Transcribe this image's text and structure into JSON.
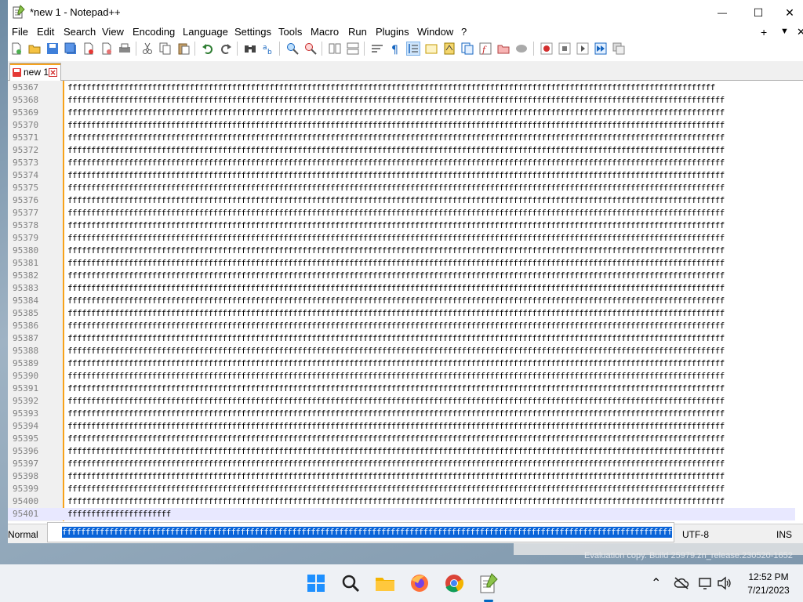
{
  "window": {
    "title": "*new 1 - Notepad++",
    "minimize_glyph": "—",
    "maximize_glyph": "☐",
    "close_glyph": "✕"
  },
  "menu": {
    "items": [
      "File",
      "Edit",
      "Search",
      "View",
      "Encoding",
      "Language",
      "Settings",
      "Tools",
      "Macro",
      "Run",
      "Plugins",
      "Window",
      "?"
    ],
    "right_plus": "+",
    "right_down": "▼",
    "right_close": "✕"
  },
  "tab": {
    "label": "new 1"
  },
  "editor": {
    "lines": [
      {
        "num": "95367",
        "text": "ffffffffffffffffffffffffffffffffffffffffffffffffffffffffffffffffffffffffffffffffffffffffffffffffffffffffffffffffffffffffffffffffffffffffff"
      },
      {
        "num": "95368",
        "text": "ffffffffffffffffffffffffffffffffffffffffffffffffffffffffffffffffffffffffffffffffffffffffffffffffffffffffffffffffffffffffffffffffffffffffffff"
      },
      {
        "num": "95369",
        "text": "ffffffffffffffffffffffffffffffffffffffffffffffffffffffffffffffffffffffffffffffffffffffffffffffffffffffffffffffffffffffffffffffffffffffffffff"
      },
      {
        "num": "95370",
        "text": "ffffffffffffffffffffffffffffffffffffffffffffffffffffffffffffffffffffffffffffffffffffffffffffffffffffffffffffffffffffffffffffffffffffffffffff"
      },
      {
        "num": "95371",
        "text": "ffffffffffffffffffffffffffffffffffffffffffffffffffffffffffffffffffffffffffffffffffffffffffffffffffffffffffffffffffffffffffffffffffffffffffff"
      },
      {
        "num": "95372",
        "text": "ffffffffffffffffffffffffffffffffffffffffffffffffffffffffffffffffffffffffffffffffffffffffffffffffffffffffffffffffffffffffffffffffffffffffffff"
      },
      {
        "num": "95373",
        "text": "ffffffffffffffffffffffffffffffffffffffffffffffffffffffffffffffffffffffffffffffffffffffffffffffffffffffffffffffffffffffffffffffffffffffffffff"
      },
      {
        "num": "95374",
        "text": "ffffffffffffffffffffffffffffffffffffffffffffffffffffffffffffffffffffffffffffffffffffffffffffffffffffffffffffffffffffffffffffffffffffffffffff"
      },
      {
        "num": "95375",
        "text": "ffffffffffffffffffffffffffffffffffffffffffffffffffffffffffffffffffffffffffffffffffffffffffffffffffffffffffffffffffffffffffffffffffffffffffff"
      },
      {
        "num": "95376",
        "text": "ffffffffffffffffffffffffffffffffffffffffffffffffffffffffffffffffffffffffffffffffffffffffffffffffffffffffffffffffffffffffffffffffffffffffffff"
      },
      {
        "num": "95377",
        "text": "ffffffffffffffffffffffffffffffffffffffffffffffffffffffffffffffffffffffffffffffffffffffffffffffffffffffffffffffffffffffffffffffffffffffffffff"
      },
      {
        "num": "95378",
        "text": "ffffffffffffffffffffffffffffffffffffffffffffffffffffffffffffffffffffffffffffffffffffffffffffffffffffffffffffffffffffffffffffffffffffffffffff"
      },
      {
        "num": "95379",
        "text": "ffffffffffffffffffffffffffffffffffffffffffffffffffffffffffffffffffffffffffffffffffffffffffffffffffffffffffffffffffffffffffffffffffffffffffff"
      },
      {
        "num": "95380",
        "text": "ffffffffffffffffffffffffffffffffffffffffffffffffffffffffffffffffffffffffffffffffffffffffffffffffffffffffffffffffffffffffffffffffffffffffffff"
      },
      {
        "num": "95381",
        "text": "ffffffffffffffffffffffffffffffffffffffffffffffffffffffffffffffffffffffffffffffffffffffffffffffffffffffffffffffffffffffffffffffffffffffffffff"
      },
      {
        "num": "95382",
        "text": "ffffffffffffffffffffffffffffffffffffffffffffffffffffffffffffffffffffffffffffffffffffffffffffffffffffffffffffffffffffffffffffffffffffffffffff"
      },
      {
        "num": "95383",
        "text": "ffffffffffffffffffffffffffffffffffffffffffffffffffffffffffffffffffffffffffffffffffffffffffffffffffffffffffffffffffffffffffffffffffffffffffff"
      },
      {
        "num": "95384",
        "text": "ffffffffffffffffffffffffffffffffffffffffffffffffffffffffffffffffffffffffffffffffffffffffffffffffffffffffffffffffffffffffffffffffffffffffffff"
      },
      {
        "num": "95385",
        "text": "ffffffffffffffffffffffffffffffffffffffffffffffffffffffffffffffffffffffffffffffffffffffffffffffffffffffffffffffffffffffffffffffffffffffffffff"
      },
      {
        "num": "95386",
        "text": "ffffffffffffffffffffffffffffffffffffffffffffffffffffffffffffffffffffffffffffffffffffffffffffffffffffffffffffffffffffffffffffffffffffffffffff"
      },
      {
        "num": "95387",
        "text": "ffffffffffffffffffffffffffffffffffffffffffffffffffffffffffffffffffffffffffffffffffffffffffffffffffffffffffffffffffffffffffffffffffffffffffff"
      },
      {
        "num": "95388",
        "text": "ffffffffffffffffffffffffffffffffffffffffffffffffffffffffffffffffffffffffffffffffffffffffffffffffffffffffffffffffffffffffffffffffffffffffffff"
      },
      {
        "num": "95389",
        "text": "ffffffffffffffffffffffffffffffffffffffffffffffffffffffffffffffffffffffffffffffffffffffffffffffffffffffffffffffffffffffffffffffffffffffffffff"
      },
      {
        "num": "95390",
        "text": "ffffffffffffffffffffffffffffffffffffffffffffffffffffffffffffffffffffffffffffffffffffffffffffffffffffffffffffffffffffffffffffffffffffffffffff"
      },
      {
        "num": "95391",
        "text": "ffffffffffffffffffffffffffffffffffffffffffffffffffffffffffffffffffffffffffffffffffffffffffffffffffffffffffffffffffffffffffffffffffffffffffff"
      },
      {
        "num": "95392",
        "text": "ffffffffffffffffffffffffffffffffffffffffffffffffffffffffffffffffffffffffffffffffffffffffffffffffffffffffffffffffffffffffffffffffffffffffffff"
      },
      {
        "num": "95393",
        "text": "ffffffffffffffffffffffffffffffffffffffffffffffffffffffffffffffffffffffffffffffffffffffffffffffffffffffffffffffffffffffffffffffffffffffffffff"
      },
      {
        "num": "95394",
        "text": "ffffffffffffffffffffffffffffffffffffffffffffffffffffffffffffffffffffffffffffffffffffffffffffffffffffffffffffffffffffffffffffffffffffffffffff"
      },
      {
        "num": "95395",
        "text": "ffffffffffffffffffffffffffffffffffffffffffffffffffffffffffffffffffffffffffffffffffffffffffffffffffffffffffffffffffffffffffffffffffffffffffff"
      },
      {
        "num": "95396",
        "text": "ffffffffffffffffffffffffffffffffffffffffffffffffffffffffffffffffffffffffffffffffffffffffffffffffffffffffffffffffffffffffffffffffffffffffffff"
      },
      {
        "num": "95397",
        "text": "ffffffffffffffffffffffffffffffffffffffffffffffffffffffffffffffffffffffffffffffffffffffffffffffffffffffffffffffffffffffffffffffffffffffffffff"
      },
      {
        "num": "95398",
        "text": "ffffffffffffffffffffffffffffffffffffffffffffffffffffffffffffffffffffffffffffffffffffffffffffffffffffffffffffffffffffffffffffffffffffffffffff"
      },
      {
        "num": "95399",
        "text": "ffffffffffffffffffffffffffffffffffffffffffffffffffffffffffffffffffffffffffffffffffffffffffffffffffffffffffffffffffffffffffffffffffffffffffff"
      },
      {
        "num": "95400",
        "text": "ffffffffffffffffffffffffffffffffffffffffffffffffffffffffffffffffffffffffffffffffffffffffffffffffffffffffffffffffffffffffffffffffffffffffffff"
      },
      {
        "num": "95401",
        "text": "ffffffffffffffffffffff"
      }
    ]
  },
  "autocomplete": {
    "selected": "ffffffffffffffffffffffffffffffffffffffffffffffffffffffffffffffffffffffffffffffffffffffffffffffffffffffffffffffffffffffffffffffffffffffffff"
  },
  "status": {
    "mode": "Normal",
    "encoding": "UTF-8",
    "insert": "INS"
  },
  "background": {
    "eval_text": "Evaluation copy. Build 25979.zn_release.230520-1652"
  },
  "taskbar": {
    "icons": [
      "windows-start-icon",
      "search-icon",
      "file-explorer-icon",
      "firefox-icon",
      "chrome-icon",
      "notepad-plus-plus-icon"
    ],
    "tray_chevron": "⌃",
    "time": "12:52 PM",
    "date": "7/21/2023"
  },
  "colors": {
    "accent": "#f7a21b",
    "selection": "#0a64d8",
    "current_line": "#e8e8ff"
  }
}
